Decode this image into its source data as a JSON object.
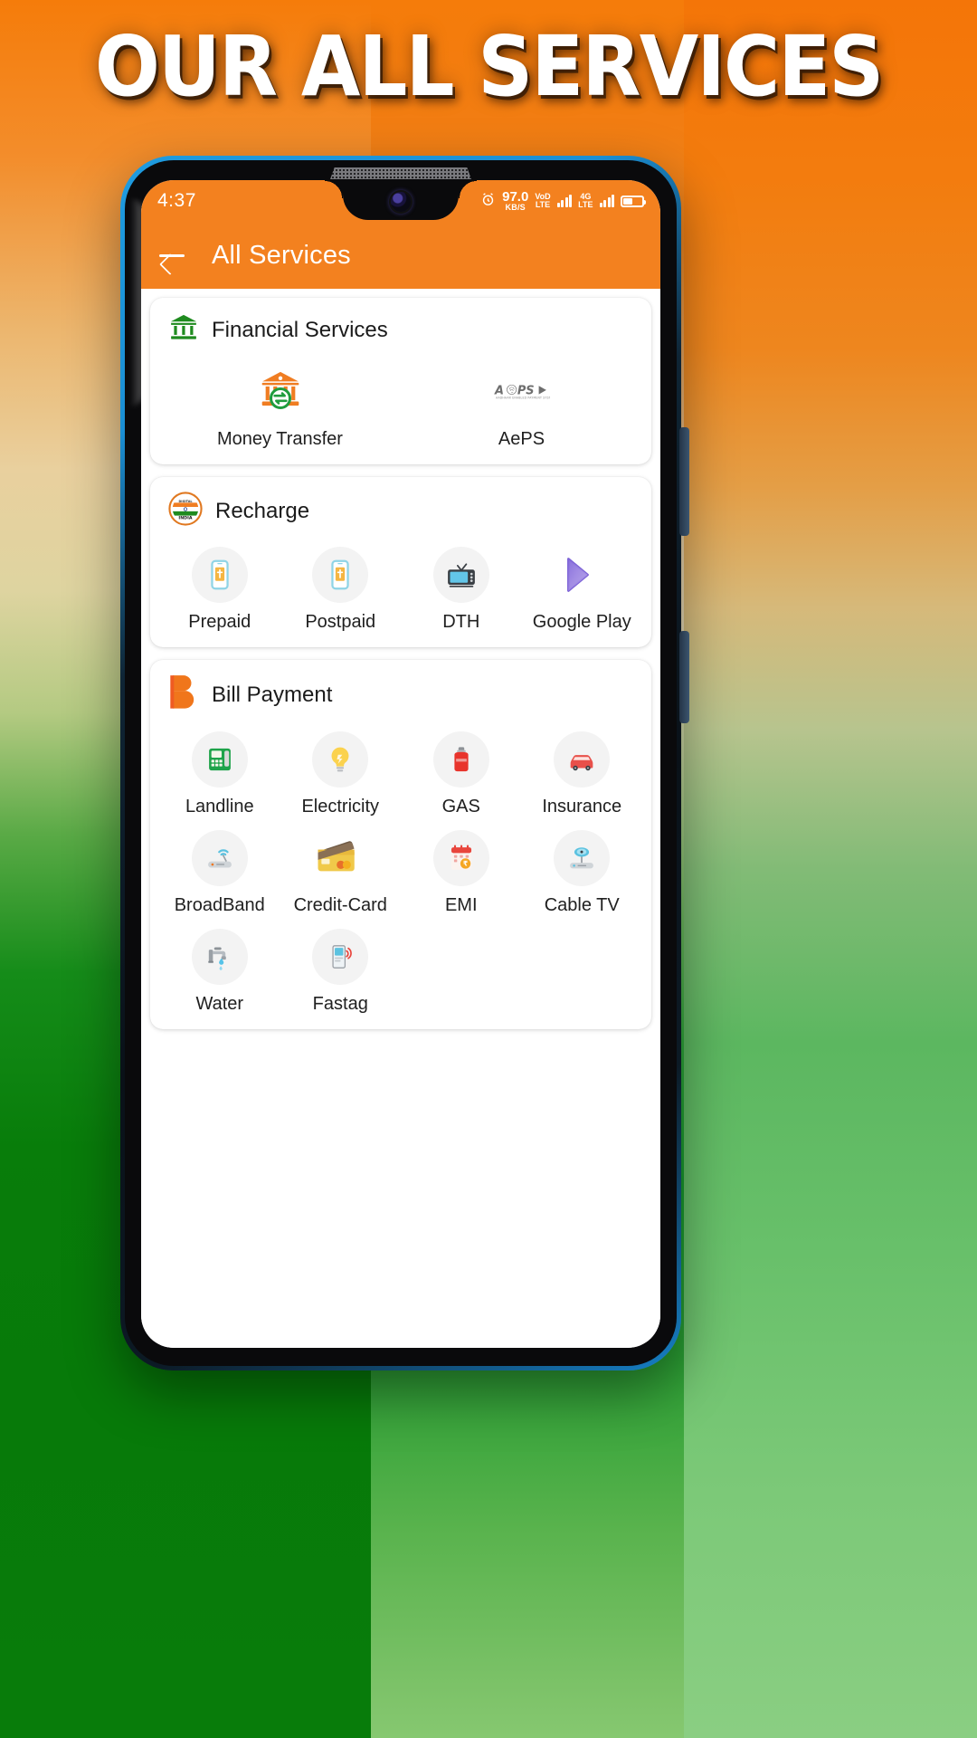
{
  "poster": {
    "headline": "OUR ALL SERVICES",
    "bg_saffron": "#f57c0a",
    "bg_green": "#0c7d0c",
    "accent": "#f3811f"
  },
  "statusbar": {
    "time": "4:37",
    "alarm_icon": "alarm-icon",
    "net_speed_value": "97.0",
    "net_speed_unit": "KB/S",
    "badge1_top": "VoD",
    "badge1_bottom": "LTE",
    "badge2_top": "4G",
    "badge2_bottom": "LTE",
    "battery_icon": "battery-icon"
  },
  "appbar": {
    "back_icon": "back-arrow-icon",
    "title": "All Services"
  },
  "sections": [
    {
      "id": "financial-services",
      "title": "Financial Services",
      "header_icon": "bank-icon",
      "columns": 2,
      "items": [
        {
          "label": "Money Transfer",
          "icon": "money-transfer-icon",
          "bg": "none"
        },
        {
          "label": "AePS",
          "icon": "aeps-logo-icon",
          "bg": "none"
        }
      ]
    },
    {
      "id": "recharge",
      "title": "Recharge",
      "header_icon": "india-flag-badge-icon",
      "columns": 4,
      "items": [
        {
          "label": "Prepaid",
          "icon": "mobile-prepaid-icon",
          "bg": "circle"
        },
        {
          "label": "Postpaid",
          "icon": "mobile-postpaid-icon",
          "bg": "circle"
        },
        {
          "label": "DTH",
          "icon": "television-icon",
          "bg": "circle"
        },
        {
          "label": "Google Play",
          "icon": "google-play-icon",
          "bg": "none"
        }
      ]
    },
    {
      "id": "bill-payment",
      "title": "Bill Payment",
      "header_icon": "bill-payment-b-icon",
      "columns": 4,
      "items": [
        {
          "label": "Landline",
          "icon": "landline-phone-icon",
          "bg": "circle"
        },
        {
          "label": "Electricity",
          "icon": "lightbulb-icon",
          "bg": "circle"
        },
        {
          "label": "GAS",
          "icon": "gas-cylinder-icon",
          "bg": "circle"
        },
        {
          "label": "Insurance",
          "icon": "car-insurance-icon",
          "bg": "circle"
        },
        {
          "label": "BroadBand",
          "icon": "wifi-router-icon",
          "bg": "circle"
        },
        {
          "label": "Credit-Card",
          "icon": "credit-card-icon",
          "bg": "none"
        },
        {
          "label": "EMI",
          "icon": "emi-calendar-icon",
          "bg": "circle"
        },
        {
          "label": "Cable TV",
          "icon": "cable-tv-dish-icon",
          "bg": "circle"
        },
        {
          "label": "Water",
          "icon": "water-tap-icon",
          "bg": "circle"
        },
        {
          "label": "Fastag",
          "icon": "fastag-icon",
          "bg": "circle"
        }
      ]
    }
  ]
}
